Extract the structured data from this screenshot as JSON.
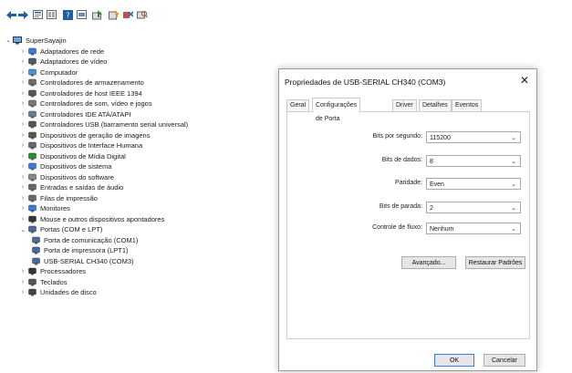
{
  "toolbar": {
    "buttons": [
      "back-icon",
      "forward-icon",
      "properties-icon",
      "view-icon",
      "help-icon",
      "show-hidden-icon",
      "update-driver-icon",
      "disable-device-icon",
      "uninstall-device-icon",
      "scan-hardware-icon"
    ]
  },
  "tree": {
    "root": "SuperSayajin",
    "items": [
      {
        "label": "Adaptadores de rede",
        "icon": "network-adapter-icon",
        "expanded": false
      },
      {
        "label": "Adaptadores de vídeo",
        "icon": "display-adapter-icon",
        "expanded": false
      },
      {
        "label": "Computador",
        "icon": "computer-icon",
        "expanded": false
      },
      {
        "label": "Controladores de armazenamento",
        "icon": "storage-controller-icon",
        "expanded": false
      },
      {
        "label": "Controladores de host IEEE 1394",
        "icon": "ieee1394-icon",
        "expanded": false
      },
      {
        "label": "Controladores de som, vídeo e jogos",
        "icon": "speaker-icon",
        "expanded": false
      },
      {
        "label": "Controladores IDE ATA/ATAPI",
        "icon": "ide-controller-icon",
        "expanded": false
      },
      {
        "label": "Controladores USB (barramento serial universal)",
        "icon": "usb-icon",
        "expanded": false
      },
      {
        "label": "Dispositivos de geração de imagens",
        "icon": "camera-icon",
        "expanded": false
      },
      {
        "label": "Dispositivos de Interface Humana",
        "icon": "hid-icon",
        "expanded": false
      },
      {
        "label": "Dispositivos de Mídia Digital",
        "icon": "media-icon",
        "expanded": false
      },
      {
        "label": "Dispositivos de sistema",
        "icon": "system-device-icon",
        "expanded": false
      },
      {
        "label": "Dispositivos do software",
        "icon": "software-device-icon",
        "expanded": false
      },
      {
        "label": "Entradas e saídas de áudio",
        "icon": "audio-icon",
        "expanded": false
      },
      {
        "label": "Filas de impressão",
        "icon": "printer-icon",
        "expanded": false
      },
      {
        "label": "Monitores",
        "icon": "monitor-icon",
        "expanded": false
      },
      {
        "label": "Mouse e outros dispositivos apontadores",
        "icon": "mouse-icon",
        "expanded": false
      },
      {
        "label": "Portas (COM e LPT)",
        "icon": "port-icon",
        "expanded": true
      },
      {
        "label": "Porta de comunicação (COM1)",
        "icon": "port-icon",
        "child": true
      },
      {
        "label": "Porta de impressora (LPT1)",
        "icon": "port-icon",
        "child": true
      },
      {
        "label": "USB-SERIAL CH340 (COM3)",
        "icon": "port-icon",
        "child": true
      },
      {
        "label": "Processadores",
        "icon": "processor-icon",
        "expanded": false
      },
      {
        "label": "Teclados",
        "icon": "keyboard-icon",
        "expanded": false
      },
      {
        "label": "Unidades de disco",
        "icon": "disk-drive-icon",
        "expanded": false
      }
    ]
  },
  "dialog": {
    "title": "Propriedades de USB-SERIAL CH340 (COM3)",
    "close": "✕",
    "tabs": [
      {
        "label": "Geral",
        "active": false
      },
      {
        "label": "Configurações de Porta",
        "active": true
      },
      {
        "label": "Driver",
        "active": false
      },
      {
        "label": "Detalhes",
        "active": false
      },
      {
        "label": "Eventos",
        "active": false
      }
    ],
    "fields": [
      {
        "label": "Bits por segundo:",
        "value": "115200"
      },
      {
        "label": "Bits de dados:",
        "value": "8"
      },
      {
        "label": "Paridade:",
        "value": "Even"
      },
      {
        "label": "Bits de parada:",
        "value": "2"
      },
      {
        "label": "Controle de fluxo:",
        "value": "Nenhum"
      }
    ],
    "advanced_button": "Avançado...",
    "restore_button": "Restaurar Padrões",
    "ok_button": "OK",
    "cancel_button": "Cancelar"
  },
  "colors": {
    "accent": "#3b7fd6",
    "dialog_border": "#9a9a9a",
    "button_bg": "#e6e6e6"
  }
}
